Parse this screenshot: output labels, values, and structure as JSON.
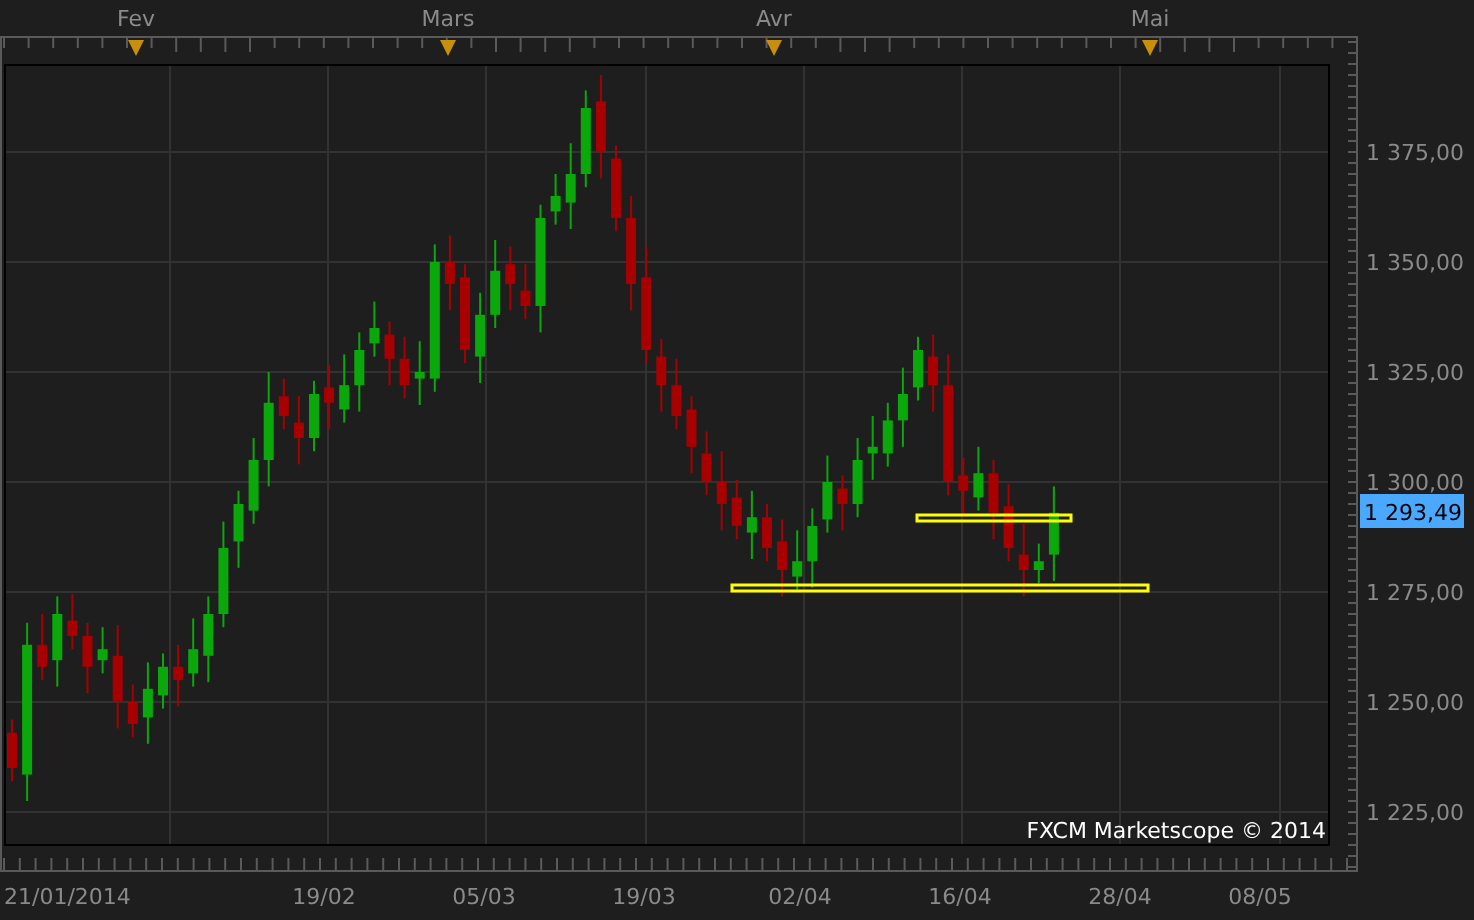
{
  "month_axis": {
    "labels": [
      "Fev",
      "Mars",
      "Avr",
      "Mai"
    ]
  },
  "price_axis": {
    "labels": [
      "1 375,00",
      "1 350,00",
      "1 325,00",
      "1 300,00",
      "1 275,00",
      "1 250,00",
      "1 225,00"
    ],
    "current_price": "1 293,49"
  },
  "date_axis": {
    "labels": [
      "21/01/2014",
      "19/02",
      "05/03",
      "19/03",
      "02/04",
      "16/04",
      "28/04",
      "08/05"
    ]
  },
  "credit": "FXCM Marketscope © 2014"
}
